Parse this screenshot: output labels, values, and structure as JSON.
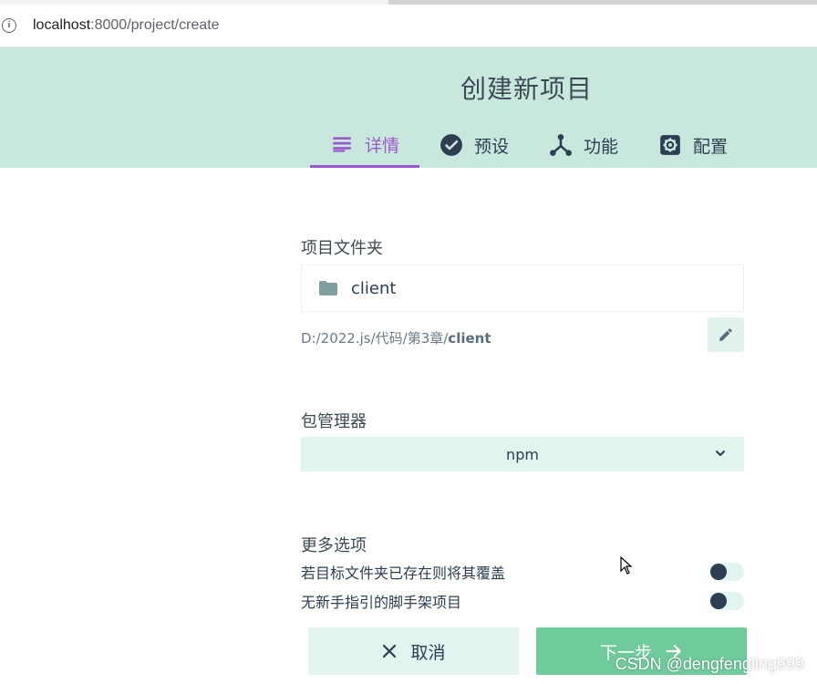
{
  "browser": {
    "url_host": "localhost",
    "url_rest": ":8000/project/create"
  },
  "header": {
    "title": "创建新项目",
    "tabs": [
      {
        "label": "详情",
        "icon": "list-icon",
        "active": true
      },
      {
        "label": "预设",
        "icon": "check-circle-icon",
        "active": false
      },
      {
        "label": "功能",
        "icon": "features-icon",
        "active": false
      },
      {
        "label": "配置",
        "icon": "gear-icon",
        "active": false
      }
    ]
  },
  "form": {
    "folder_label": "项目文件夹",
    "folder_value": "client",
    "path_prefix": "D:/2022.js/代码/第3章/",
    "path_folder": "client",
    "package_manager_label": "包管理器",
    "package_manager_value": "npm",
    "more_options_label": "更多选项",
    "options": [
      {
        "label": "若目标文件夹已存在则将其覆盖",
        "enabled": false
      },
      {
        "label": "无新手指引的脚手架项目",
        "enabled": false
      }
    ]
  },
  "actions": {
    "cancel_label": "取消",
    "next_label": "下一步"
  },
  "watermark": "CSDN @dengfengling999",
  "colors": {
    "header_bg": "#c8e8de",
    "accent_purple": "#9b59d0",
    "primary_green": "#6fcb9b",
    "light_green": "#e2f4ee",
    "text_dark": "#2c3e50"
  }
}
